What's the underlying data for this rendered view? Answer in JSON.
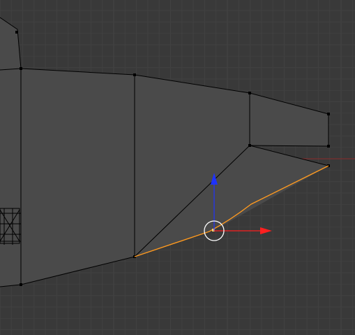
{
  "app": "Blender",
  "view": {
    "mode": "edit-mode",
    "shading": "solid"
  },
  "colors": {
    "background": "#393939",
    "grid_minor": "#414141",
    "grid_major": "#454545",
    "x_axis_line": "#8a2b2b",
    "mesh_face": "#4a4a4a",
    "mesh_edge": "#000000",
    "selected_edge": "#ff9a1f",
    "selected_vertex": "#ffd06b",
    "gizmo_x": "#ff1f1f",
    "gizmo_z": "#1e32ff",
    "gizmo_ring": "#ffffff"
  },
  "gizmo": {
    "type": "translate-manipulator",
    "axes": [
      "x",
      "z"
    ]
  },
  "selection": {
    "elements": "edge-loop",
    "count_vertices": 3
  }
}
